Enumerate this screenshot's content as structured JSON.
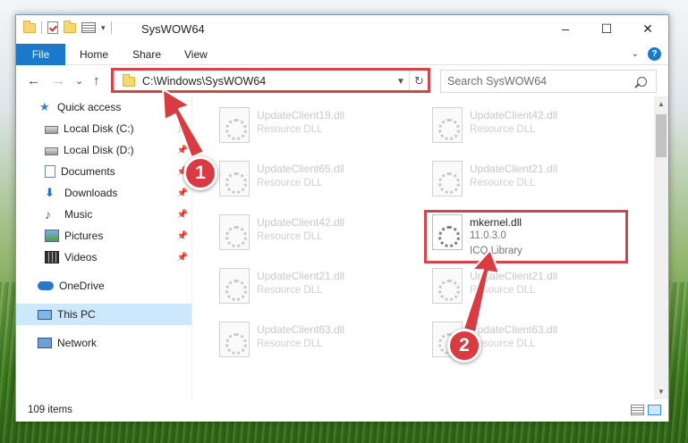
{
  "window": {
    "title": "SysWOW64",
    "controls": {
      "minimize": "–",
      "maximize": "☐",
      "close": "✕"
    }
  },
  "ribbon": {
    "file": "File",
    "tabs": [
      "Home",
      "Share",
      "View"
    ],
    "collapse_icon": "chevron-down-icon",
    "help_label": "?"
  },
  "nav": {
    "back": "←",
    "forward": "→",
    "recent": "⌄",
    "up": "↑",
    "address": "C:\\Windows\\SysWOW64",
    "refresh": "↻",
    "search_placeholder": "Search SysWOW64"
  },
  "sidebar": {
    "items": [
      {
        "label": "Quick access",
        "icon": "star-icon",
        "pinned": false
      },
      {
        "label": "Local Disk (C:)",
        "icon": "disk-icon",
        "pinned": true
      },
      {
        "label": "Local Disk (D:)",
        "icon": "disk-icon",
        "pinned": true
      },
      {
        "label": "Documents",
        "icon": "documents-icon",
        "pinned": true
      },
      {
        "label": "Downloads",
        "icon": "downloads-icon",
        "pinned": true
      },
      {
        "label": "Music",
        "icon": "music-icon",
        "pinned": true
      },
      {
        "label": "Pictures",
        "icon": "pictures-icon",
        "pinned": true
      },
      {
        "label": "Videos",
        "icon": "videos-icon",
        "pinned": true
      },
      {
        "label": "OneDrive",
        "icon": "onedrive-icon",
        "pinned": false
      },
      {
        "label": "This PC",
        "icon": "this-pc-icon",
        "pinned": false,
        "selected": true
      },
      {
        "label": "Network",
        "icon": "network-icon",
        "pinned": false
      }
    ]
  },
  "files": [
    {
      "name": "UpdateClient19.dll",
      "type": "Resource DLL"
    },
    {
      "name": "UpdateClient42.dll",
      "type": "Resource DLL"
    },
    {
      "name": "UpdateClient65.dll",
      "type": "Resource DLL"
    },
    {
      "name": "UpdateClient21.dll",
      "type": "Resource DLL"
    },
    {
      "name": "UpdateClient42.dll",
      "type": "Resource DLL"
    },
    {
      "name": "mkernel.dll",
      "version": "11.0.3.0",
      "type": "ICQ Library",
      "highlighted": true
    },
    {
      "name": "UpdateClient21.dll",
      "type": "Resource DLL"
    },
    {
      "name": "UpdateClient21.dll",
      "type": "Resource DLL"
    },
    {
      "name": "UpdateClient63.dll",
      "type": "Resource DLL"
    },
    {
      "name": "UpdateClient63.dll",
      "type": "Resource DLL"
    }
  ],
  "status": {
    "items": "109 items"
  },
  "annotations": {
    "step1": "1",
    "step2": "2",
    "color": "#d93b43"
  },
  "colors": {
    "accent": "#1979ca",
    "highlight": "#d4444a",
    "selected": "#cce8ff"
  }
}
